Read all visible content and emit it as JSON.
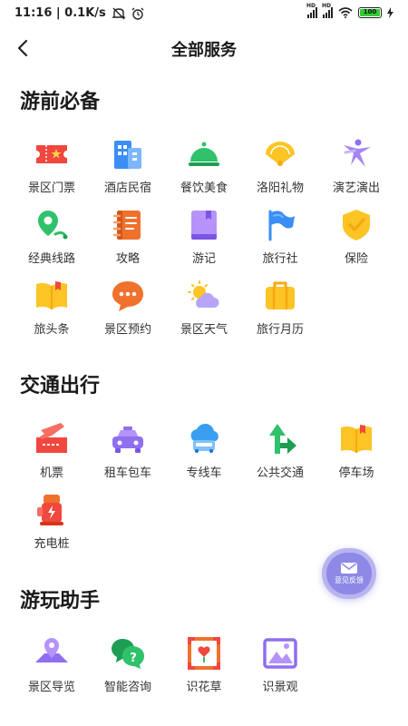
{
  "status_bar": {
    "time_speed": "11:16 | 0.1K/s",
    "battery": "100",
    "hd_label": "HD"
  },
  "nav": {
    "title": "全部服务"
  },
  "sections": [
    {
      "title": "游前必备",
      "items": [
        {
          "label": "景区门票",
          "icon": "ticket-icon"
        },
        {
          "label": "酒店民宿",
          "icon": "hotel-icon"
        },
        {
          "label": "餐饮美食",
          "icon": "food-cloche-icon"
        },
        {
          "label": "洛阳礼物",
          "icon": "gift-fan-icon"
        },
        {
          "label": "演艺演出",
          "icon": "dancer-icon"
        },
        {
          "label": "经典线路",
          "icon": "route-pin-icon"
        },
        {
          "label": "攻略",
          "icon": "notebook-icon"
        },
        {
          "label": "游记",
          "icon": "journal-book-icon"
        },
        {
          "label": "旅行社",
          "icon": "flag-icon"
        },
        {
          "label": "保险",
          "icon": "shield-check-icon"
        },
        {
          "label": "旅头条",
          "icon": "open-book-icon"
        },
        {
          "label": "景区预约",
          "icon": "chat-bubble-icon"
        },
        {
          "label": "景区天气",
          "icon": "weather-icon"
        },
        {
          "label": "旅行月历",
          "icon": "suitcase-icon"
        }
      ]
    },
    {
      "title": "交通出行",
      "items": [
        {
          "label": "机票",
          "icon": "plane-ticket-icon"
        },
        {
          "label": "租车包车",
          "icon": "taxi-icon"
        },
        {
          "label": "专线车",
          "icon": "cloud-bus-icon"
        },
        {
          "label": "公共交通",
          "icon": "direction-arrows-icon"
        },
        {
          "label": "停车场",
          "icon": "parking-book-icon"
        },
        {
          "label": "充电桩",
          "icon": "charging-pile-icon"
        }
      ]
    },
    {
      "title": "游玩助手",
      "items": [
        {
          "label": "景区导览",
          "icon": "map-pin-icon"
        },
        {
          "label": "智能咨询",
          "icon": "chat-question-icon"
        },
        {
          "label": "识花草",
          "icon": "flower-frame-icon"
        },
        {
          "label": "识景观",
          "icon": "landscape-frame-icon"
        }
      ]
    }
  ],
  "feedback": {
    "label": "意见反馈",
    "icon": "feedback-mail-icon"
  },
  "colors": {
    "red": "#f0483e",
    "blue": "#3a8ef6",
    "green": "#2fc26a",
    "yellow": "#fcc425",
    "purple": "#8f6ff0",
    "accent": "#8e88e6"
  }
}
